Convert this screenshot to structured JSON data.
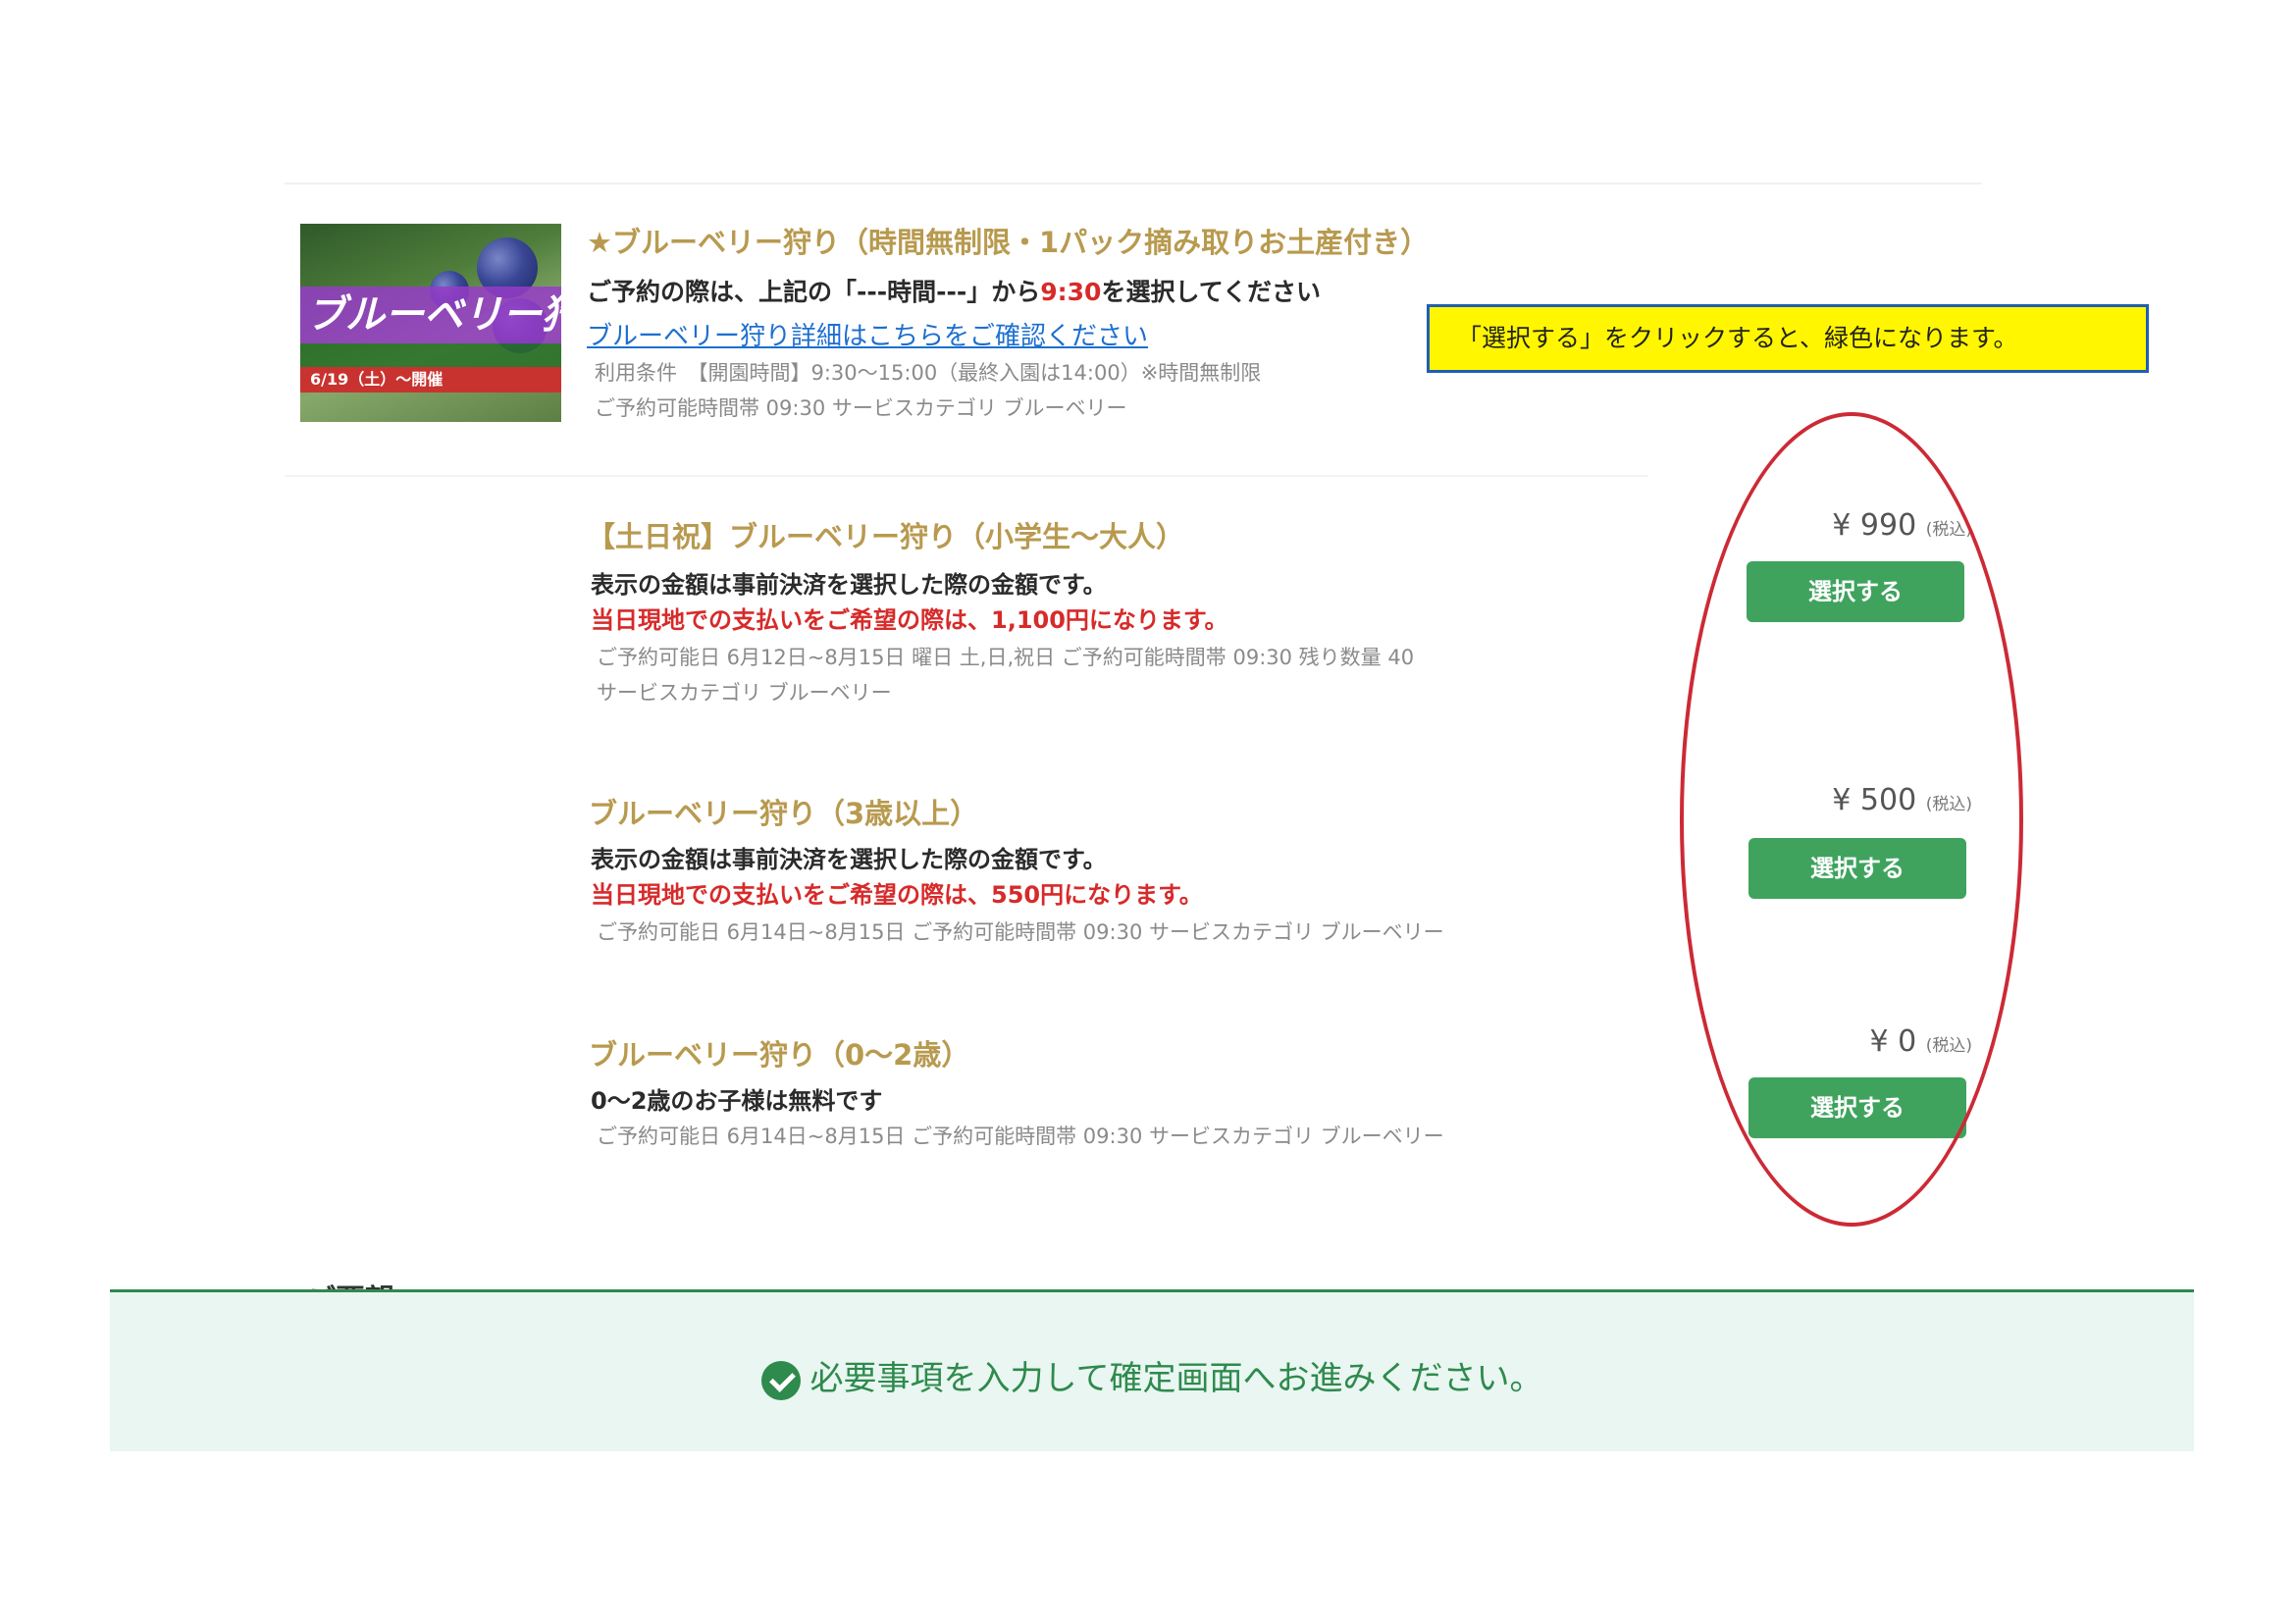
{
  "main_plan": {
    "image": {
      "title": "ブルーベリー狩り",
      "subtitle": "6/19（土）〜開催"
    },
    "title": "★ブルーベリー狩り（時間無制限・1パック摘み取りお土産付き）",
    "instruction_prefix": "ご予約の際は、上記の「---時間---」から",
    "instruction_time": "9:30",
    "instruction_suffix": "を選択してください",
    "detail_link": "ブルーベリー狩り詳細はこちらをご確認ください",
    "conditions": "利用条件　【開園時間】9:30〜15:00（最終入園は14:00）※時間無制限",
    "meta": "ご予約可能時間帯 09:30  サービスカテゴリ ブルーベリー"
  },
  "note": "「選択する」をクリックすると、緑色になります。",
  "options": [
    {
      "title": "【土日祝】ブルーベリー狩り（小学生〜大人）",
      "line1": "表示の金額は事前決済を選択した際の金額です。",
      "line2": "当日現地での支払いをご希望の際は、1,100円になります。",
      "meta1": "ご予約可能日 6月12日~8月15日  曜日 土,日,祝日  ご予約可能時間帯 09:30  残り数量 40",
      "meta2": "サービスカテゴリ ブルーベリー",
      "price": "¥ 990",
      "tax": "(税込)",
      "button": "選択する"
    },
    {
      "title": "ブルーベリー狩り（3歳以上）",
      "line1": "表示の金額は事前決済を選択した際の金額です。",
      "line2": "当日現地での支払いをご希望の際は、550円になります。",
      "meta1": "ご予約可能日 6月14日~8月15日  ご予約可能時間帯 09:30  サービスカテゴリ ブルーベリー",
      "price": "¥ 500",
      "tax": "(税込)",
      "button": "選択する"
    },
    {
      "title": "ブルーベリー狩り（0〜2歳）",
      "line1": "0〜2歳のお子様は無料です",
      "meta1": "ご予約可能日 6月14日~8月15日  ご予約可能時間帯 09:30  サービスカテゴリ ブルーベリー",
      "price": "¥ 0",
      "tax": "(税込)",
      "button": "選択する"
    }
  ],
  "partial_heading": "ご要望",
  "banner": {
    "icon": "check-circle-icon",
    "text": "必要事項を入力して確定画面へお進みください。"
  },
  "colors": {
    "title_gold": "#b89a4f",
    "warning_red": "#d72a2a",
    "button_green": "#3fa35e",
    "banner_green": "#2e8a4d",
    "highlight_ellipse": "#cc2a35",
    "note_bg": "#fff600",
    "note_border": "#1e5fb3"
  }
}
